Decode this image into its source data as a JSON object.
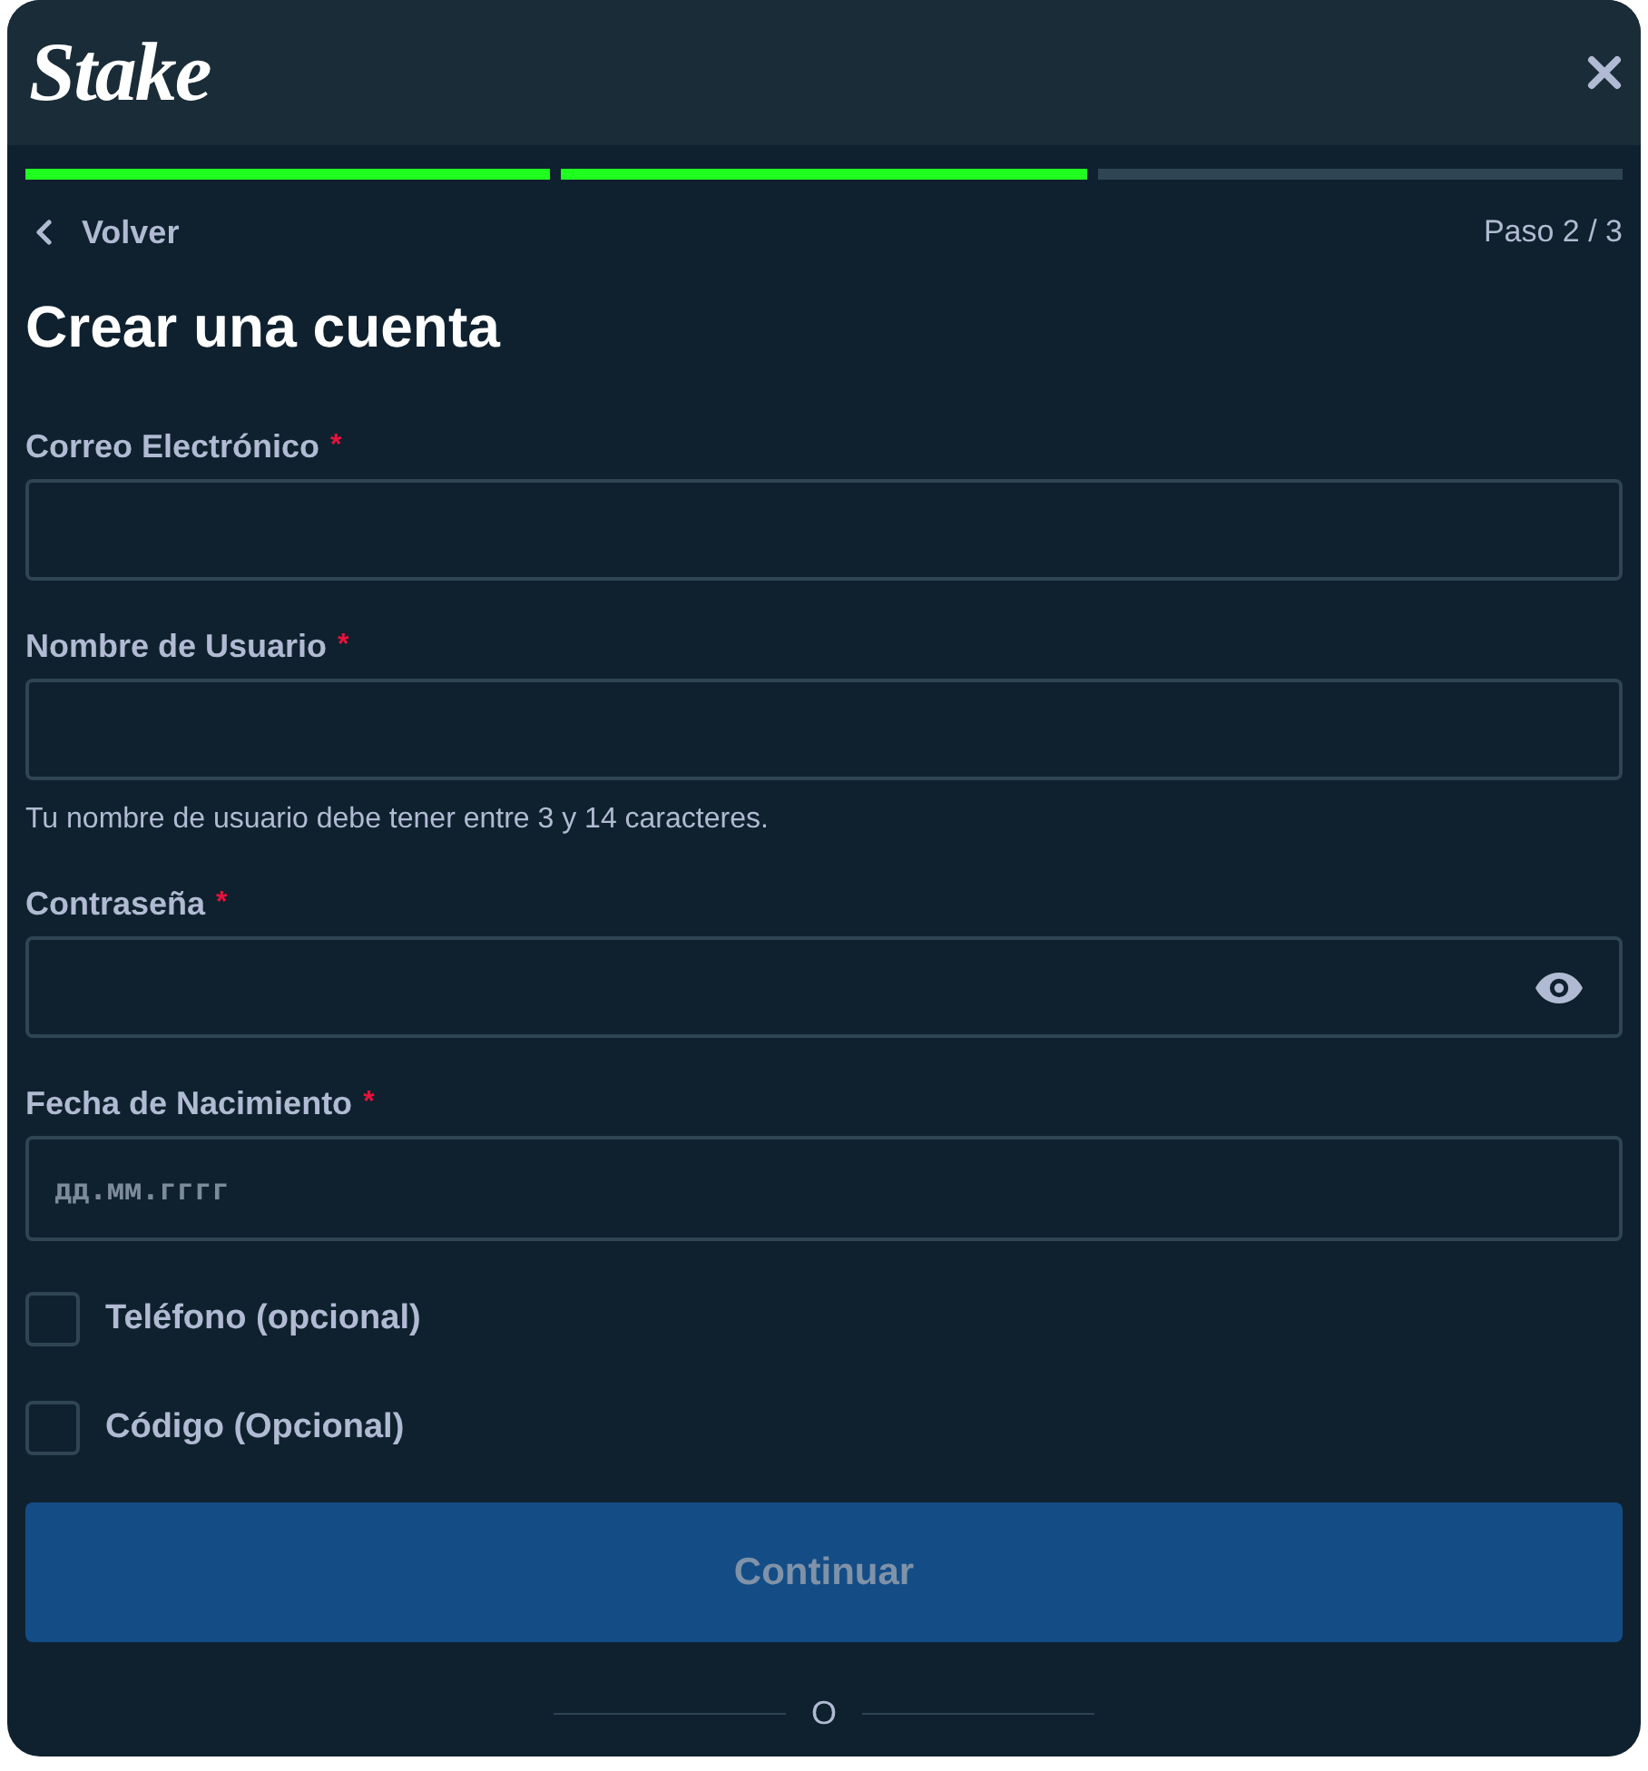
{
  "header": {
    "logo": "Stake"
  },
  "progress": [
    {
      "completed": true
    },
    {
      "completed": true
    },
    {
      "completed": false
    }
  ],
  "nav": {
    "back": "Volver",
    "step": "Paso 2 / 3"
  },
  "title": "Crear una cuenta",
  "fields": [
    {
      "kind": "text",
      "label": "Correo Electrónico",
      "required_mark": "*"
    },
    {
      "kind": "text",
      "label": "Nombre de Usuario",
      "required_mark": "*",
      "hint": "Tu nombre de usuario debe tener entre 3 y 14 caracteres."
    },
    {
      "kind": "password",
      "label": "Contraseña",
      "required_mark": "*"
    },
    {
      "kind": "date",
      "label": "Fecha de Nacimiento",
      "required_mark": "*",
      "placeholder": "дд.мм.гггг"
    }
  ],
  "options": [
    {
      "label": "Teléfono (opcional)",
      "checked": false
    },
    {
      "label": "Código (Opcional)",
      "checked": false
    }
  ],
  "submit": {
    "label": "Continuar",
    "disabled": true
  },
  "divider": {
    "text": "O"
  }
}
